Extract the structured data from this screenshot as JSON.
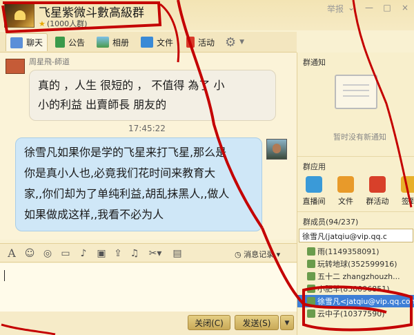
{
  "header": {
    "title": "飞星紫微斗數高級群",
    "member_count": "(1000人群)",
    "report": "举报",
    "window_controls": [
      "⌄",
      "—",
      "□",
      "×"
    ]
  },
  "tabs": [
    {
      "label": "聊天",
      "icon": "chat-icon"
    },
    {
      "label": "公告",
      "icon": "flag-icon"
    },
    {
      "label": "相册",
      "icon": "photo-icon"
    },
    {
      "label": "文件",
      "icon": "folder-icon"
    },
    {
      "label": "活动",
      "icon": "red-flag-icon"
    }
  ],
  "chat": {
    "msg1_sender": "周星飛-師道",
    "msg1_line1": "真的 ，人生 很短的 ， 不值得  為了 小",
    "msg1_line2": "小的利益    出賣師長 朋友的",
    "time": "17:45:22",
    "msg2_lines": [
      "徐雪凡如果你是学的飞星来打飞星,那么是",
      "你是真小人也,必竟我们花时间来教育大",
      "家,,你们却为了单纯利益,胡乱抹黑人,,做人",
      "如果做成这样,,我看不必为人"
    ]
  },
  "toolbar": {
    "message_log": "消息记录"
  },
  "buttons": {
    "close": "关闭(C)",
    "send": "发送(S)"
  },
  "right_panel": {
    "notice_title": "群通知",
    "notice_empty": "暂时没有新通知",
    "apps_title": "群应用",
    "apps": [
      "直播间",
      "文件",
      "群活动",
      "签到"
    ],
    "members_title": "群成员(94/237)",
    "member_search": "徐雪凡(jatqiu@vip.qq.c",
    "members": [
      "雨(1149358091)",
      "玩转地球(352599916)",
      "五十二 zhangzhouzh...",
      "小肥羊(850096851)",
      "徐雪凡<jatqiu@vip.qq.com>",
      "云中子(10377590)"
    ]
  },
  "colors": {
    "accent_red": "#c40000",
    "bubble_blue": "#cfe7f7",
    "selected_row": "#3e7fd6"
  }
}
